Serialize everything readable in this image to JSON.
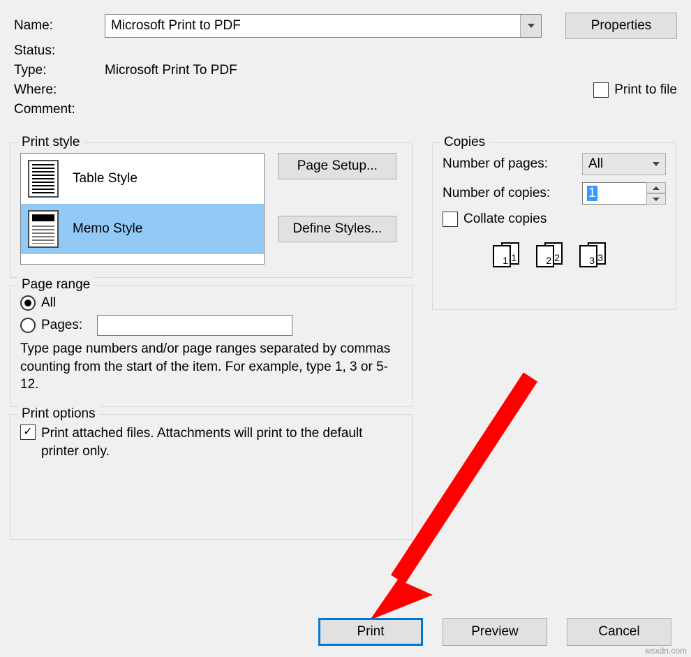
{
  "printer": {
    "name_label": "Name:",
    "name_value": "Microsoft Print to PDF",
    "status_label": "Status:",
    "status_value": "",
    "type_label": "Type:",
    "type_value": "Microsoft Print To PDF",
    "where_label": "Where:",
    "where_value": "",
    "comment_label": "Comment:",
    "comment_value": "",
    "properties_button": "Properties",
    "print_to_file_label": "Print to file",
    "print_to_file_checked": false
  },
  "print_style": {
    "legend": "Print style",
    "items": [
      {
        "label": "Table Style",
        "selected": false
      },
      {
        "label": "Memo Style",
        "selected": true
      }
    ],
    "page_setup_button": "Page Setup...",
    "define_styles_button": "Define Styles..."
  },
  "page_range": {
    "legend": "Page range",
    "all_label": "All",
    "all_selected": true,
    "pages_label": "Pages:",
    "pages_selected": false,
    "pages_value": "",
    "hint": "Type page numbers and/or page ranges separated by commas counting from the start of the item.  For example, type 1, 3 or 5-12."
  },
  "print_options": {
    "legend": "Print options",
    "attached_label": "Print attached files.  Attachments will print to the default printer only.",
    "attached_checked": true
  },
  "copies": {
    "legend": "Copies",
    "num_pages_label": "Number of pages:",
    "num_pages_value": "All",
    "num_copies_label": "Number of copies:",
    "num_copies_value": "1",
    "collate_label": "Collate copies",
    "collate_checked": false,
    "collate_preview": [
      "1",
      "1",
      "2",
      "2",
      "3",
      "3"
    ]
  },
  "buttons": {
    "print": "Print",
    "preview": "Preview",
    "cancel": "Cancel"
  },
  "watermark": "wsxdn.com"
}
